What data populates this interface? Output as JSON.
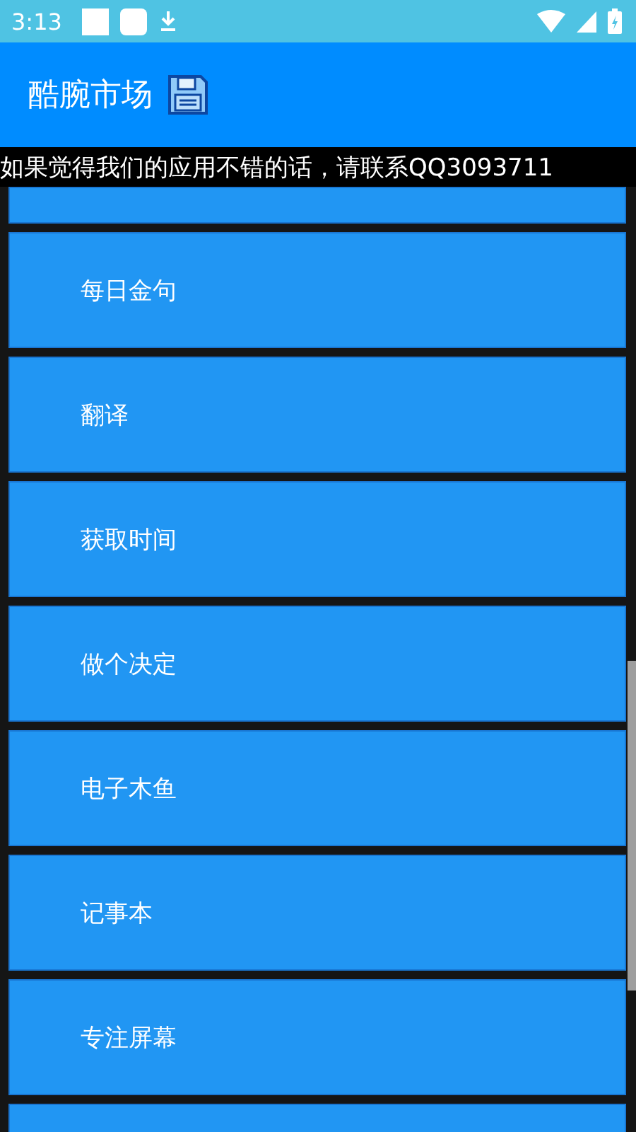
{
  "status_bar": {
    "time": "3:13"
  },
  "app_bar": {
    "title": "酷腕市场"
  },
  "marquee": "如果觉得我们的应用不错的话，请联系QQ3093711",
  "menu_items": [
    {
      "label": "每日金句"
    },
    {
      "label": "翻译"
    },
    {
      "label": "获取时间"
    },
    {
      "label": "做个决定"
    },
    {
      "label": "电子木鱼"
    },
    {
      "label": "记事本"
    },
    {
      "label": "专注屏幕"
    }
  ]
}
